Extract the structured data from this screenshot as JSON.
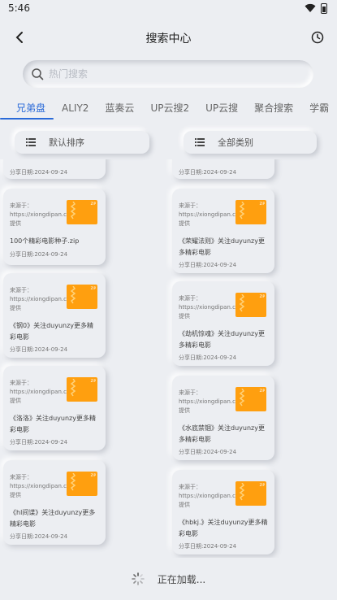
{
  "status": {
    "time": "5:46"
  },
  "header": {
    "title": "搜索中心"
  },
  "search": {
    "placeholder": "热门搜索"
  },
  "tabs": [
    "兄弟盘",
    "ALIY2",
    "蓝奏云",
    "UP云搜2",
    "UP云搜",
    "聚合搜索",
    "学霸"
  ],
  "filters": {
    "sort_label": "默认排序",
    "category_label": "全部类别"
  },
  "cards": {
    "source_text": "来源于：https://xiongdipan.com/提供",
    "date_text": "分享日期:2024-09-24",
    "left": [
      {
        "title": ""
      },
      {
        "title": "100个精彩电影种子.zip"
      },
      {
        "title": "《钢0》关注duyunzy更多精彩电影"
      },
      {
        "title": "《洛洛》关注duyunzy更多精彩电影"
      },
      {
        "title": "《hl间谍》关注duyunzy更多精彩电影"
      }
    ],
    "right": [
      {
        "title": ""
      },
      {
        "title": "《荣耀法则》关注duyunzy更多精彩电影"
      },
      {
        "title": "《劫机惊魂》关注duyunzy更多精彩电影"
      },
      {
        "title": "《水底禁锢》关注duyunzy更多精彩电影"
      },
      {
        "title": "《hbkj.》关注duyunzy更多精彩电影"
      }
    ]
  },
  "loading": {
    "text": "正在加载..."
  },
  "colors": {
    "accent": "#2a6ad8",
    "thumb": "#ff9f0f",
    "background": "#eceef2"
  }
}
